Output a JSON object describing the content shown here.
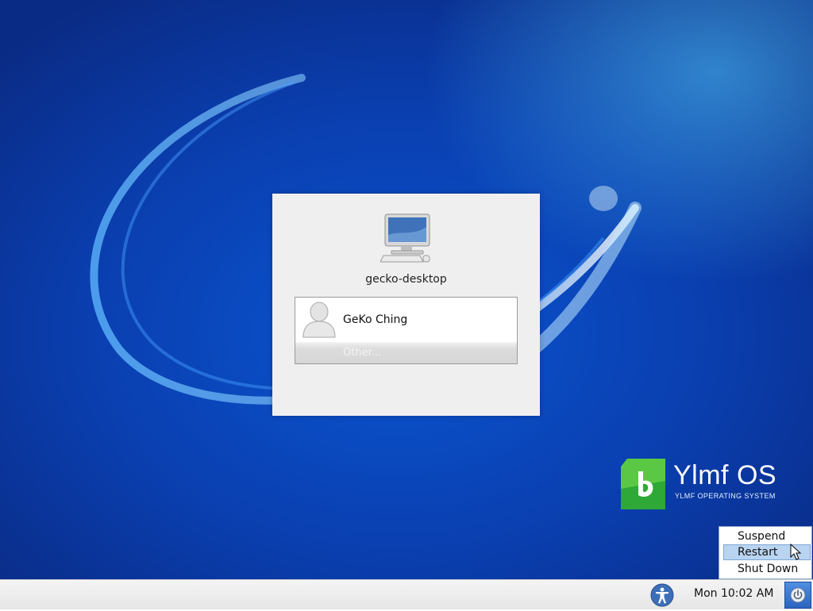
{
  "login": {
    "hostname": "gecko-desktop",
    "users": [
      {
        "name": "GeKo Ching"
      }
    ],
    "other_label": "Other..."
  },
  "brand": {
    "title": "Ylmf OS",
    "subtitle": "YLMF OPERATING SYSTEM"
  },
  "power_menu": {
    "items": [
      "Suspend",
      "Restart",
      "Shut Down"
    ],
    "highlighted": "Restart"
  },
  "panel": {
    "clock": "Mon 10:02 AM",
    "accessibility_icon": "accessibility-icon",
    "power_icon": "power-icon"
  },
  "colors": {
    "desktop_blue": "#0a4fc8",
    "logo_green": "#3cb23c",
    "menu_highlight": "#b9d4f0"
  }
}
